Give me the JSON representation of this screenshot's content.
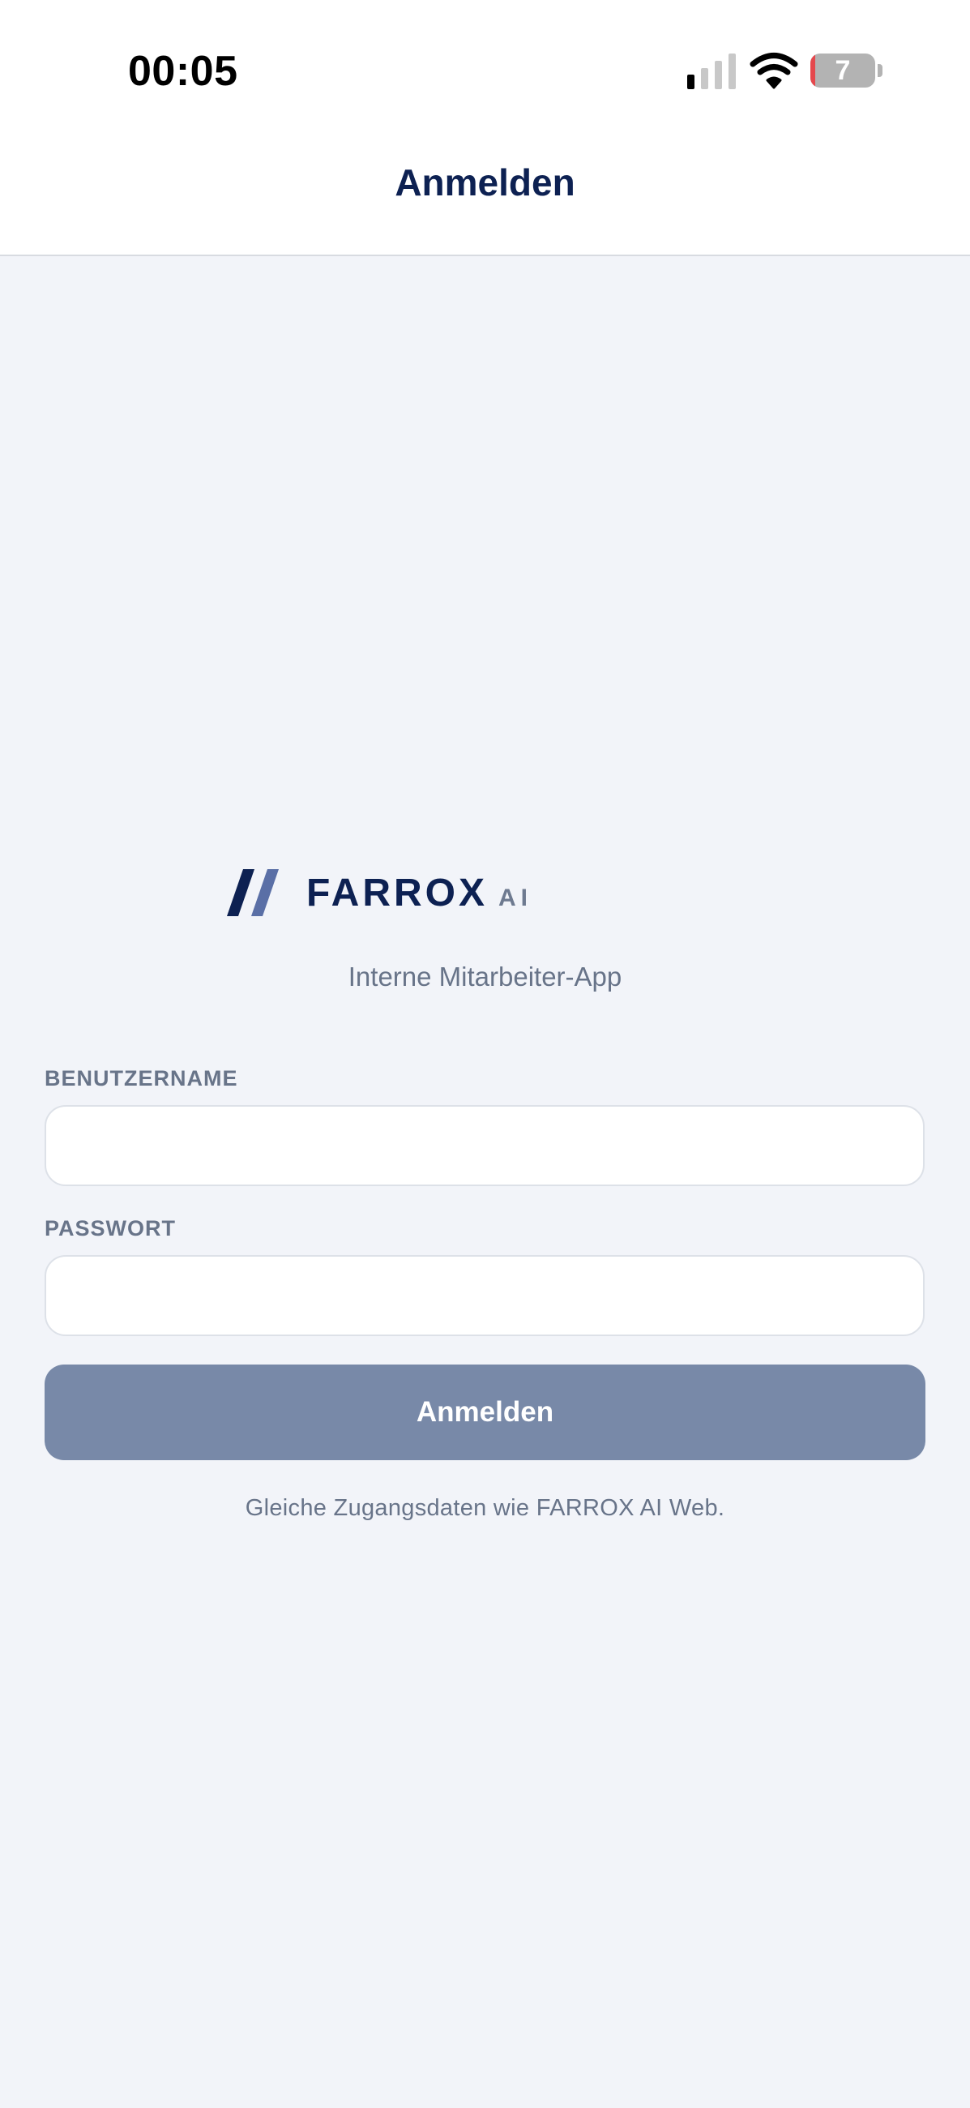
{
  "status_bar": {
    "time": "00:05",
    "battery_level": "7",
    "battery_fraction": 0.07,
    "battery_color": "#e5484d",
    "signal_icon": "cellular-signal-icon",
    "wifi_icon": "wifi-icon"
  },
  "nav": {
    "title": "Anmelden"
  },
  "logo": {
    "word": "FARROX",
    "suffix": "AI",
    "icon": "farrox-logo-mark"
  },
  "subtitle": "Interne Mitarbeiter-App",
  "form": {
    "username": {
      "label": "BENUTZERNAME",
      "value": ""
    },
    "password": {
      "label": "PASSWORT",
      "value": ""
    },
    "submit_label": "Anmelden"
  },
  "hint": "Gleiche Zugangsdaten wie FARROX AI Web.",
  "colors": {
    "brand_navy": "#0d2152",
    "button": "#7889a8",
    "background": "#f2f4f9",
    "muted_text": "#687489"
  }
}
